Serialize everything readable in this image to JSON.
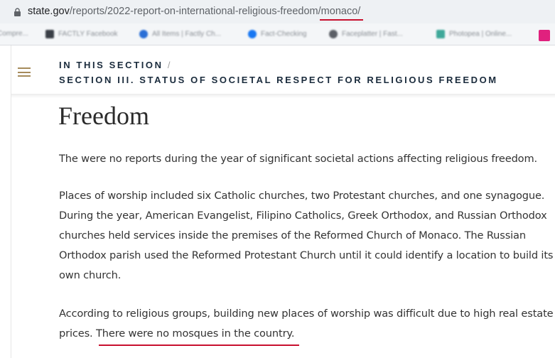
{
  "browser": {
    "url_host": "state.gov",
    "url_path": "/reports/2022-report-on-international-religious-freedom/",
    "url_tail": "monaco/",
    "bookmarks": [
      {
        "label": "Compre...",
        "icon": "page-icon"
      },
      {
        "label": "FACTLY Facebook",
        "icon": "factly-icon"
      },
      {
        "label": "All Items | Factly Ch...",
        "icon": "c-icon"
      },
      {
        "label": "Fact-Checking",
        "icon": "facebook-icon"
      },
      {
        "label": "Faceplatter | Fast...",
        "icon": "globe-icon"
      },
      {
        "label": "Photopea | Online...",
        "icon": "photopea-icon"
      }
    ]
  },
  "header": {
    "section_label": "IN THIS SECTION",
    "separator": "/",
    "section_title": "SECTION III. STATUS OF SOCIETAL RESPECT FOR RELIGIOUS FREEDOM"
  },
  "main": {
    "heading": "Freedom",
    "paragraph1": "The were no reports during the year of significant societal actions affecting religious freedom.",
    "paragraph2": "Places of worship included six Catholic churches, two Protestant churches, and one synagogue. During the year, American Evangelist, Filipino Catholics, Greek Orthodox, and Russian Orthodox churches held services inside the premises of the Reformed Church of Monaco.  The Russian Orthodox parish used the Reformed Protestant Church until it could identify a location to build its own church.",
    "paragraph3_start": "According to religious groups, building new places of worship was difficult due to high real estate prices.  ",
    "paragraph3_highlight": "There were no mosques in the country."
  },
  "colors": {
    "annotation_red": "#c8102e",
    "hamburger_gold": "#a68b5b",
    "section_navy": "#1a2b3c"
  }
}
